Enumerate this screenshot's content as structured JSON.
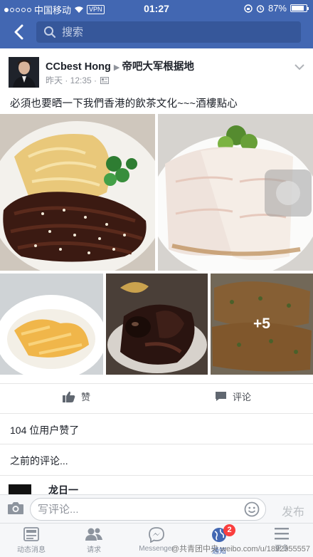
{
  "status_bar": {
    "carrier": "中国移动",
    "vpn": "VPN",
    "time": "01:27",
    "battery": "87%",
    "battery_level": 0.87
  },
  "search": {
    "placeholder": "搜索"
  },
  "post": {
    "author": "CCbest Hong",
    "target": "帝吧大军根据地",
    "time": "昨天 · 12:35 ·",
    "text": "必須也要晒一下我們香港的飲茶文化~~~酒樓點心",
    "more_photos": "+5"
  },
  "actions": {
    "like": "赞",
    "comment": "评论"
  },
  "likes_summary": "104 位用户赞了",
  "previous_comments": "之前的评论...",
  "comment_preview": {
    "name": "龙日一"
  },
  "composer": {
    "placeholder": "写评论...",
    "publish": "发布"
  },
  "tabs": [
    {
      "label": "动态消息",
      "icon": "news-feed-icon"
    },
    {
      "label": "请求",
      "icon": "friend-requests-icon"
    },
    {
      "label": "Messenger",
      "icon": "messenger-icon"
    },
    {
      "label": "通知",
      "icon": "notifications-globe-icon",
      "badge": "2"
    },
    {
      "label": "更多",
      "icon": "menu-icon"
    }
  ],
  "watermark": "@共青团中央 weibo.com/u/1892355557",
  "colors": {
    "brand": "#4267b2",
    "badge": "#fa3e3e"
  }
}
